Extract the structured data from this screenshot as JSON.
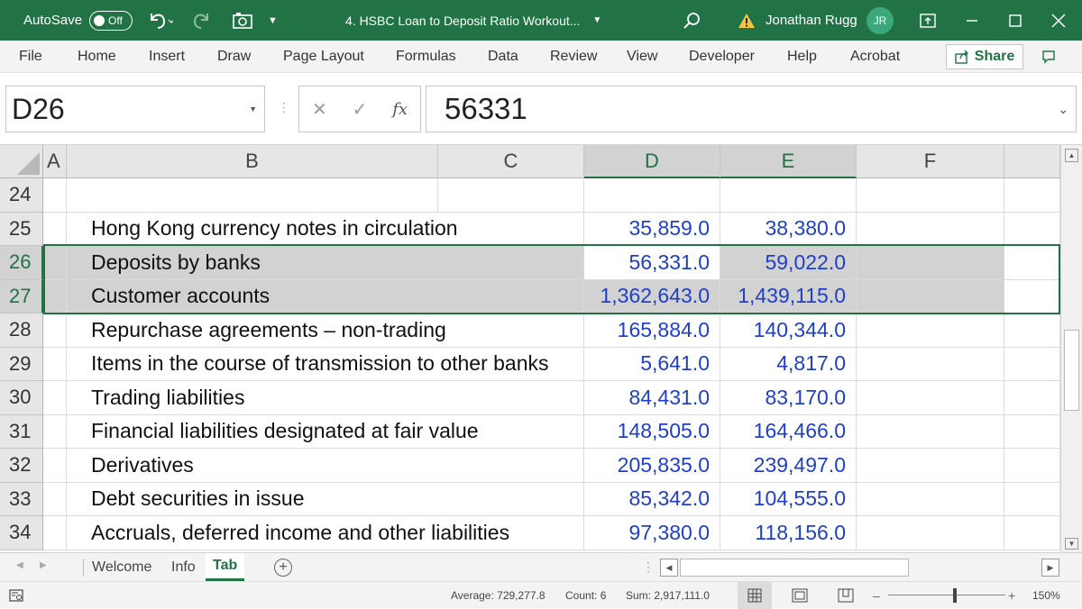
{
  "titlebar": {
    "autosave_label": "AutoSave",
    "autosave_state": "Off",
    "doc_title": "4. HSBC Loan to Deposit Ratio Workout...",
    "user_name": "Jonathan Rugg",
    "user_initials": "JR"
  },
  "ribbon": {
    "tabs": [
      "File",
      "Home",
      "Insert",
      "Draw",
      "Page Layout",
      "Formulas",
      "Data",
      "Review",
      "View",
      "Developer",
      "Help",
      "Acrobat"
    ],
    "share_label": "Share"
  },
  "formula_bar": {
    "name_box": "D26",
    "fx_label": "fx",
    "value": "56331"
  },
  "columns": [
    "A",
    "B",
    "C",
    "D",
    "E",
    "F"
  ],
  "rows": [
    {
      "num": "24",
      "label": "",
      "d": "",
      "e": ""
    },
    {
      "num": "25",
      "label": "Hong Kong currency notes in circulation",
      "d": "35,859.0",
      "e": "38,380.0"
    },
    {
      "num": "26",
      "label": "Deposits by banks",
      "d": "56,331.0",
      "e": "59,022.0"
    },
    {
      "num": "27",
      "label": "Customer accounts",
      "d": "1,362,643.0",
      "e": "1,439,115.0"
    },
    {
      "num": "28",
      "label": "Repurchase agreements – non-trading",
      "d": "165,884.0",
      "e": "140,344.0"
    },
    {
      "num": "29",
      "label": "Items in the course of transmission to other banks",
      "d": "5,641.0",
      "e": "4,817.0"
    },
    {
      "num": "30",
      "label": "Trading liabilities",
      "d": "84,431.0",
      "e": "83,170.0"
    },
    {
      "num": "31",
      "label": "Financial liabilities designated at fair value",
      "d": "148,505.0",
      "e": "164,466.0"
    },
    {
      "num": "32",
      "label": "Derivatives",
      "d": "205,835.0",
      "e": "239,497.0"
    },
    {
      "num": "33",
      "label": "Debt securities in issue",
      "d": "85,342.0",
      "e": "104,555.0"
    },
    {
      "num": "34",
      "label": "Accruals, deferred income and other liabilities",
      "d": "97,380.0",
      "e": "118,156.0"
    }
  ],
  "selected_rows": [
    "26",
    "27"
  ],
  "sheets": [
    "Welcome",
    "Info",
    "Tab"
  ],
  "active_sheet": "Tab",
  "status": {
    "average": "Average: 729,277.8",
    "count": "Count: 6",
    "sum": "Sum: 2,917,111.0",
    "zoom": "150%"
  },
  "colors": {
    "accent": "#217346",
    "number_blue": "#1f3fc8",
    "selection_fill": "#d2d2d2"
  }
}
